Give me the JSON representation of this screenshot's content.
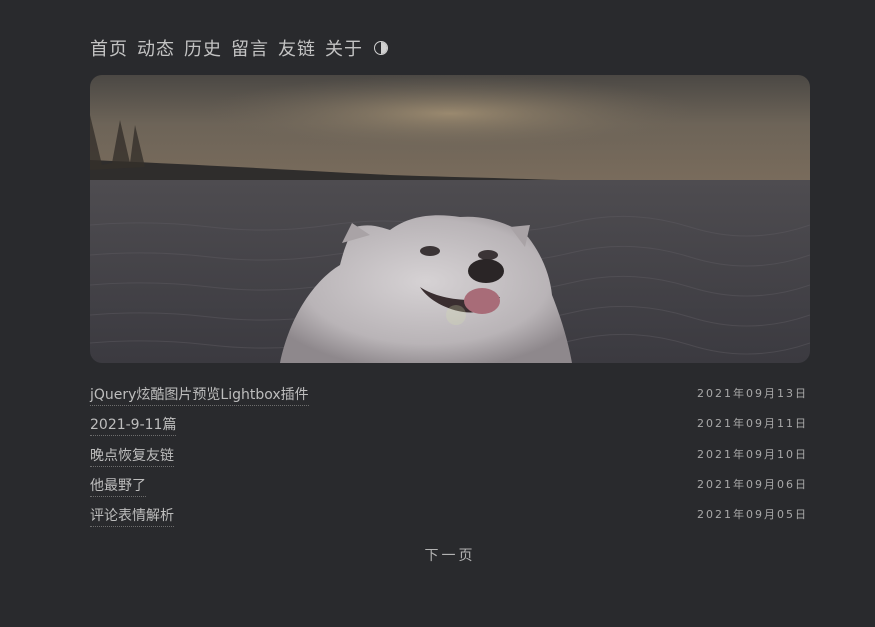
{
  "nav": {
    "items": [
      {
        "label": "首页"
      },
      {
        "label": "动态"
      },
      {
        "label": "历史"
      },
      {
        "label": "留言"
      },
      {
        "label": "友链"
      },
      {
        "label": "关于"
      }
    ],
    "theme_icon": "half-circle-icon"
  },
  "hero": {
    "icon": "samoyed-dog-photo"
  },
  "posts": [
    {
      "title": "jQuery炫酷图片预览Lightbox插件",
      "date": "2021年09月13日"
    },
    {
      "title": "2021-9-11篇",
      "date": "2021年09月11日"
    },
    {
      "title": "晚点恢复友链",
      "date": "2021年09月10日"
    },
    {
      "title": "他最野了",
      "date": "2021年09月06日"
    },
    {
      "title": "评论表情解析",
      "date": "2021年09月05日"
    }
  ],
  "pager": {
    "next_label": "下一页"
  },
  "colors": {
    "background": "#292a2d",
    "text": "#bdbdbd"
  }
}
